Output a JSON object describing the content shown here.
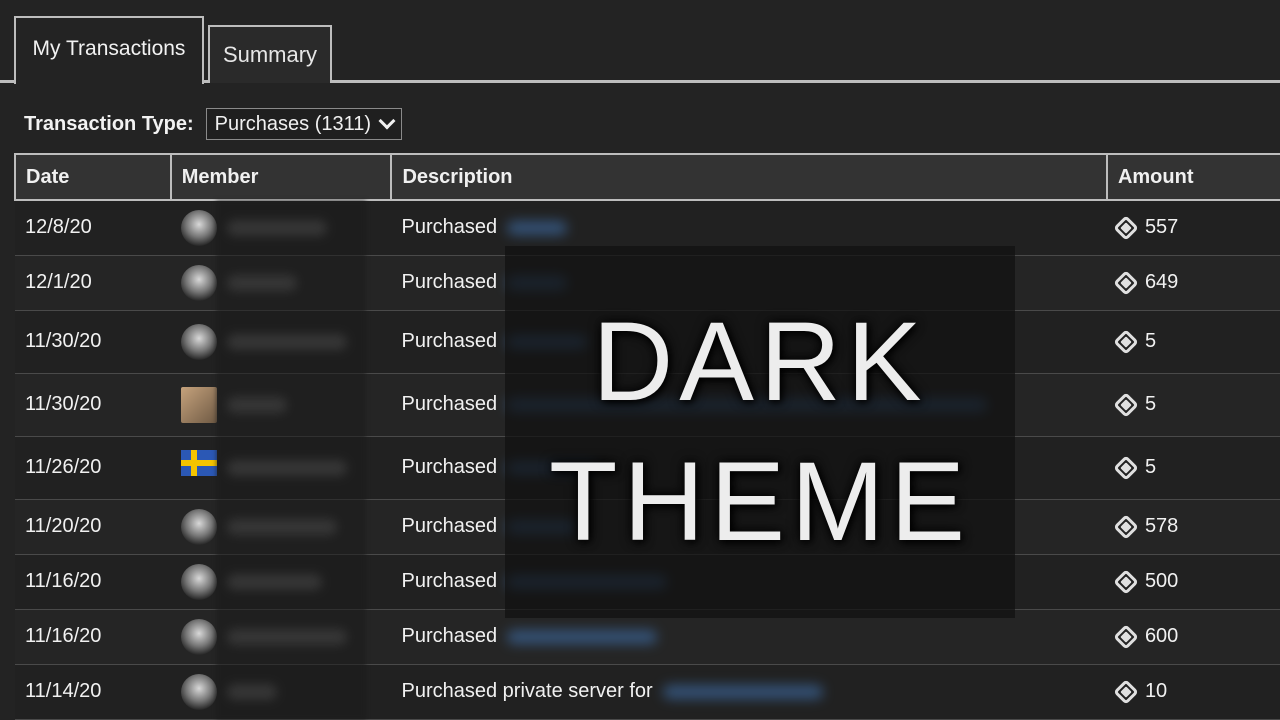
{
  "tabs": [
    {
      "label": "My Transactions",
      "active": true
    },
    {
      "label": "Summary",
      "active": false
    }
  ],
  "filter": {
    "label": "Transaction Type:",
    "selected": "Purchases (1311)"
  },
  "table": {
    "headers": [
      "Date",
      "Member",
      "Description",
      "Amount"
    ],
    "rows": [
      {
        "date": "12/8/20",
        "description": "Purchased",
        "amount": "557"
      },
      {
        "date": "12/1/20",
        "description": "Purchased",
        "amount": "649"
      },
      {
        "date": "11/30/20",
        "description": "Purchased",
        "amount": "5"
      },
      {
        "date": "11/30/20",
        "description": "Purchased",
        "amount": "5"
      },
      {
        "date": "11/26/20",
        "description": "Purchased",
        "amount": "5"
      },
      {
        "date": "11/20/20",
        "description": "Purchased",
        "amount": "578"
      },
      {
        "date": "11/16/20",
        "description": "Purchased",
        "amount": "500"
      },
      {
        "date": "11/16/20",
        "description": "Purchased",
        "amount": "600"
      },
      {
        "date": "11/14/20",
        "description": "Purchased private server for",
        "amount": "10"
      }
    ]
  },
  "overlay": {
    "line1": "DARK",
    "line2": "THEME"
  },
  "icons": {
    "currency": "robux-icon",
    "dropdown": "chevron-down-icon"
  }
}
